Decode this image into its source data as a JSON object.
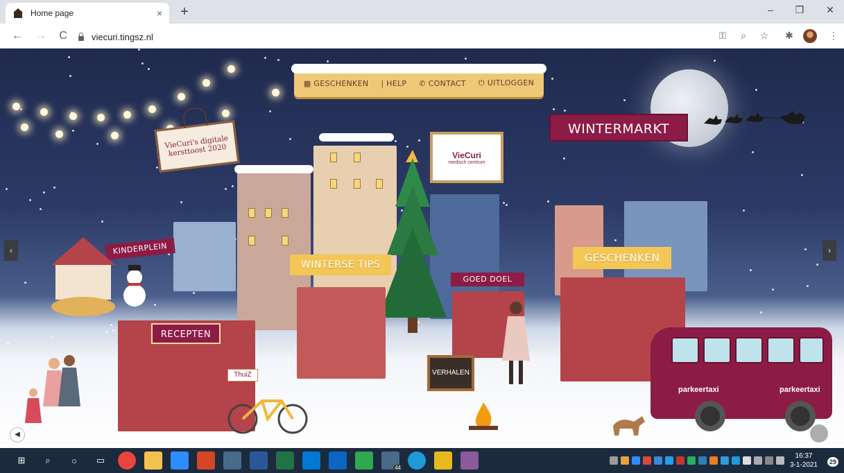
{
  "browser": {
    "tab_title": "Home page",
    "tab_close": "×",
    "new_tab": "+",
    "url": "viecuri.tingsz.nl",
    "window_controls": {
      "minimize": "–",
      "maximize": "❐",
      "close": "✕"
    },
    "nav": {
      "back": "←",
      "forward": "→",
      "reload": "C"
    },
    "toolbar_icons": [
      "key-icon",
      "zoom-icon",
      "star-icon",
      "extensions-icon",
      "profile-icon",
      "menu-icon"
    ]
  },
  "page": {
    "menu": [
      {
        "label": "GESCHENKEN",
        "icon": "gift-icon"
      },
      {
        "label": "HELP",
        "icon": "help-icon"
      },
      {
        "label": "CONTACT",
        "icon": "phone-icon"
      },
      {
        "label": "UITLOGGEN",
        "icon": "power-icon"
      }
    ],
    "hanging_sign": "VieCuri's digitale kersttoost 2020",
    "signs": {
      "wintermarkt": "WINTERMARKT",
      "kinderplein": "KINDERPLEIN",
      "winterse_tips": "WINTERSE TIPS",
      "goed_doel": "GOED DOEL",
      "geschenken": "GESCHENKEN",
      "recepten": "RECEPTEN",
      "verhalen": "VERHALEN",
      "thuiz": "ThuiZ"
    },
    "logo": {
      "mark": "VieCuri",
      "sub": "medisch centrum"
    },
    "bus_text": "parkeertaxi",
    "prev_arrow": "‹",
    "next_arrow": "›",
    "sound_icon": "◀"
  },
  "taskbar": {
    "clock_time": "16:37",
    "clock_date": "3-1-2021",
    "notification_count": "29",
    "mail_badge": "44"
  },
  "colors": {
    "accent": "#8c1c45",
    "sign_yellow": "#f3c655",
    "sky_top": "#1f2a4d",
    "taskbar": "#1c2a3e"
  }
}
